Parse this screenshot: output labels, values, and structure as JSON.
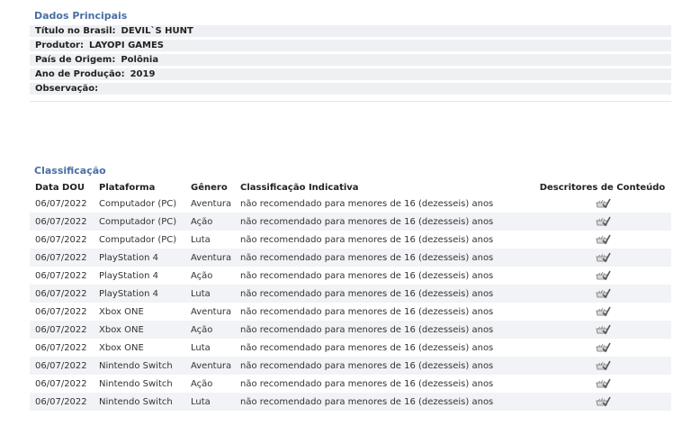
{
  "main": {
    "title": "Dados Principais",
    "fields": [
      {
        "label": "Título no Brasil:",
        "value": "DEVIL`S HUNT"
      },
      {
        "label": "Produtor:",
        "value": "LAYOPI GAMES"
      },
      {
        "label": "País de Origem:",
        "value": "Polônia"
      },
      {
        "label": "Ano de Produção:",
        "value": "2019"
      },
      {
        "label": "Observação:",
        "value": ""
      }
    ]
  },
  "classificacao": {
    "title": "Classificação",
    "headers": [
      "Data DOU",
      "Plataforma",
      "Gênero",
      "Classificação Indicativa",
      "Descritores de Conteúdo"
    ],
    "rows": [
      {
        "data": "06/07/2022",
        "plataforma": "Computador (PC)",
        "genero": "Aventura",
        "classificacao": "não recomendado para menores de 16 (dezesseis) anos",
        "descritor_icon": "descriptor-icon"
      },
      {
        "data": "06/07/2022",
        "plataforma": "Computador (PC)",
        "genero": "Ação",
        "classificacao": "não recomendado para menores de 16 (dezesseis) anos",
        "descritor_icon": "descriptor-icon"
      },
      {
        "data": "06/07/2022",
        "plataforma": "Computador (PC)",
        "genero": "Luta",
        "classificacao": "não recomendado para menores de 16 (dezesseis) anos",
        "descritor_icon": "descriptor-icon"
      },
      {
        "data": "06/07/2022",
        "plataforma": "PlayStation 4",
        "genero": "Aventura",
        "classificacao": "não recomendado para menores de 16 (dezesseis) anos",
        "descritor_icon": "descriptor-icon"
      },
      {
        "data": "06/07/2022",
        "plataforma": "PlayStation 4",
        "genero": "Ação",
        "classificacao": "não recomendado para menores de 16 (dezesseis) anos",
        "descritor_icon": "descriptor-icon"
      },
      {
        "data": "06/07/2022",
        "plataforma": "PlayStation 4",
        "genero": "Luta",
        "classificacao": "não recomendado para menores de 16 (dezesseis) anos",
        "descritor_icon": "descriptor-icon"
      },
      {
        "data": "06/07/2022",
        "plataforma": "Xbox ONE",
        "genero": "Aventura",
        "classificacao": "não recomendado para menores de 16 (dezesseis) anos",
        "descritor_icon": "descriptor-icon"
      },
      {
        "data": "06/07/2022",
        "plataforma": "Xbox ONE",
        "genero": "Ação",
        "classificacao": "não recomendado para menores de 16 (dezesseis) anos",
        "descritor_icon": "descriptor-icon"
      },
      {
        "data": "06/07/2022",
        "plataforma": "Xbox ONE",
        "genero": "Luta",
        "classificacao": "não recomendado para menores de 16 (dezesseis) anos",
        "descritor_icon": "descriptor-icon"
      },
      {
        "data": "06/07/2022",
        "plataforma": "Nintendo Switch",
        "genero": "Aventura",
        "classificacao": "não recomendado para menores de 16 (dezesseis) anos",
        "descritor_icon": "descriptor-icon"
      },
      {
        "data": "06/07/2022",
        "plataforma": "Nintendo Switch",
        "genero": "Ação",
        "classificacao": "não recomendado para menores de 16 (dezesseis) anos",
        "descritor_icon": "descriptor-icon"
      },
      {
        "data": "06/07/2022",
        "plataforma": "Nintendo Switch",
        "genero": "Luta",
        "classificacao": "não recomendado para menores de 16 (dezesseis) anos",
        "descritor_icon": "descriptor-icon"
      }
    ]
  },
  "colors": {
    "section_title": "#4a6fa5",
    "rating_text": "#8a1fa0",
    "row_shade": "#f1f3f6"
  }
}
